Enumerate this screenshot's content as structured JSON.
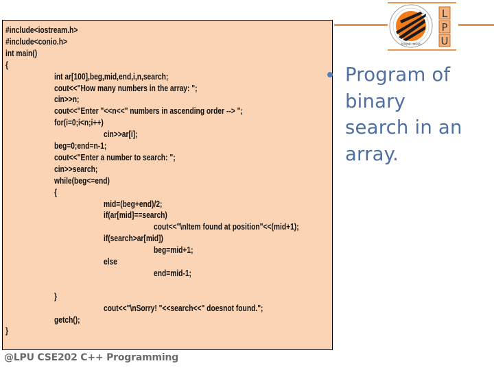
{
  "slide": {
    "logo": {
      "letters": [
        "L",
        "P",
        "U"
      ],
      "seal_text_top": "LOVELY PROFESSIONAL UNIVERSITY",
      "seal_text_bottom": "PUNJAB (INDIA)",
      "accent_color": "#e8944a"
    },
    "code": {
      "background_color": "#fad4b4",
      "lines": [
        {
          "indent": 0,
          "text": "#include<iostream.h>"
        },
        {
          "indent": 0,
          "text": "#include<conio.h>"
        },
        {
          "indent": 0,
          "text": "int main()"
        },
        {
          "indent": 0,
          "text": "{"
        },
        {
          "indent": 1,
          "text": "int ar[100],beg,mid,end,i,n,search;"
        },
        {
          "indent": 1,
          "text": "cout<<\"How many numbers in the array: \";"
        },
        {
          "indent": 1,
          "text": "cin>>n;"
        },
        {
          "indent": 1,
          "text": "cout<<\"Enter \"<<n<<\" numbers in ascending order --> \";"
        },
        {
          "indent": 1,
          "text": "for(i=0;i<n;i++)"
        },
        {
          "indent": 2,
          "text": "cin>>ar[i];"
        },
        {
          "indent": 1,
          "text": "beg=0;end=n-1;"
        },
        {
          "indent": 1,
          "text": "cout<<\"Enter a number to search: \";"
        },
        {
          "indent": 1,
          "text": "cin>>search;"
        },
        {
          "indent": 1,
          "text": "while(beg<=end)"
        },
        {
          "indent": 1,
          "text": "{"
        },
        {
          "indent": 2,
          "text": "mid=(beg+end)/2;"
        },
        {
          "indent": 2,
          "text": "if(ar[mid]==search)"
        },
        {
          "indent": 3,
          "text": "cout<<\"\\nItem found at position\"<<(mid+1);"
        },
        {
          "indent": 2,
          "text": "if(search>ar[mid])"
        },
        {
          "indent": 3,
          "text": "beg=mid+1;"
        },
        {
          "indent": 2,
          "text": "else"
        },
        {
          "indent": 3,
          "text": "end=mid-1;"
        },
        {
          "indent": 1,
          "text": "}"
        },
        {
          "indent": 2,
          "text": "cout<<\"\\nSorry! \"<<search<<\" doesnot found.\";"
        },
        {
          "indent": 1,
          "text": "getch();"
        },
        {
          "indent": 0,
          "text": "}"
        }
      ]
    },
    "bullet": {
      "text": "Program of binary search in an array.",
      "lines": [
        "Program of",
        "binary",
        "search in an",
        "array."
      ],
      "color": "#4f6fa0"
    },
    "footer": {
      "text": "@LPU CSE202 C++ Programming"
    }
  }
}
